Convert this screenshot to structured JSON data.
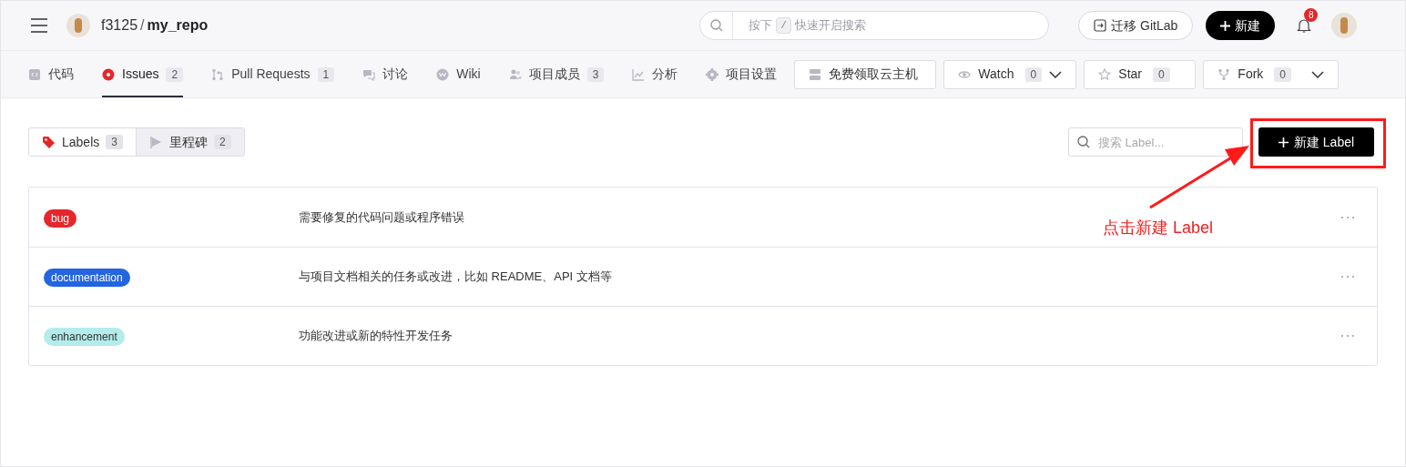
{
  "header": {
    "owner": "f3125",
    "separator": "/",
    "repo": "my_repo",
    "search": {
      "prefix": "按下",
      "key": "/",
      "suffix": "快速开启搜索"
    },
    "migrate_button": "迁移 GitLab",
    "new_button": "新建",
    "notification_count": "8"
  },
  "nav_tabs": [
    {
      "kind": "code",
      "label": "代码",
      "selected": false
    },
    {
      "kind": "issues",
      "label": "Issues",
      "count": "2",
      "selected": true
    },
    {
      "kind": "pull",
      "label": "Pull Requests",
      "count": "1",
      "selected": false
    },
    {
      "kind": "discuss",
      "label": "讨论",
      "selected": false
    },
    {
      "kind": "wiki",
      "label": "Wiki",
      "selected": false
    },
    {
      "kind": "members",
      "label": "项目成员",
      "count": "3",
      "selected": false
    },
    {
      "kind": "analytics",
      "label": "分析",
      "selected": false
    },
    {
      "kind": "settings",
      "label": "项目设置",
      "selected": false
    }
  ],
  "repo_actions": [
    {
      "kind": "server",
      "label": "免费领取云主机"
    },
    {
      "kind": "watch",
      "label": "Watch",
      "count": "0",
      "dropdown": true
    },
    {
      "kind": "star",
      "label": "Star",
      "count": "0",
      "dropdown": false
    },
    {
      "kind": "fork",
      "label": "Fork",
      "count": "0",
      "dropdown": true
    }
  ],
  "sub_tabs": [
    {
      "kind": "labels",
      "label": "Labels",
      "count": "3",
      "selected": true
    },
    {
      "kind": "milestones",
      "label": "里程碑",
      "count": "2",
      "selected": false
    }
  ],
  "label_search": {
    "placeholder": "搜索 Label..."
  },
  "new_label_button": "新建 Label",
  "labels": [
    {
      "name": "bug",
      "color": "#e5262a",
      "description": "需要修复的代码问题或程序错误"
    },
    {
      "name": "documentation",
      "color": "#2464e0",
      "description": "与项目文档相关的任务或改进，比如 README、API 文档等"
    },
    {
      "name": "enhancement",
      "color": "#b3eceb",
      "description": "功能改进或新的特性开发任务"
    }
  ],
  "annotation": {
    "text": "点击新建 Label"
  }
}
